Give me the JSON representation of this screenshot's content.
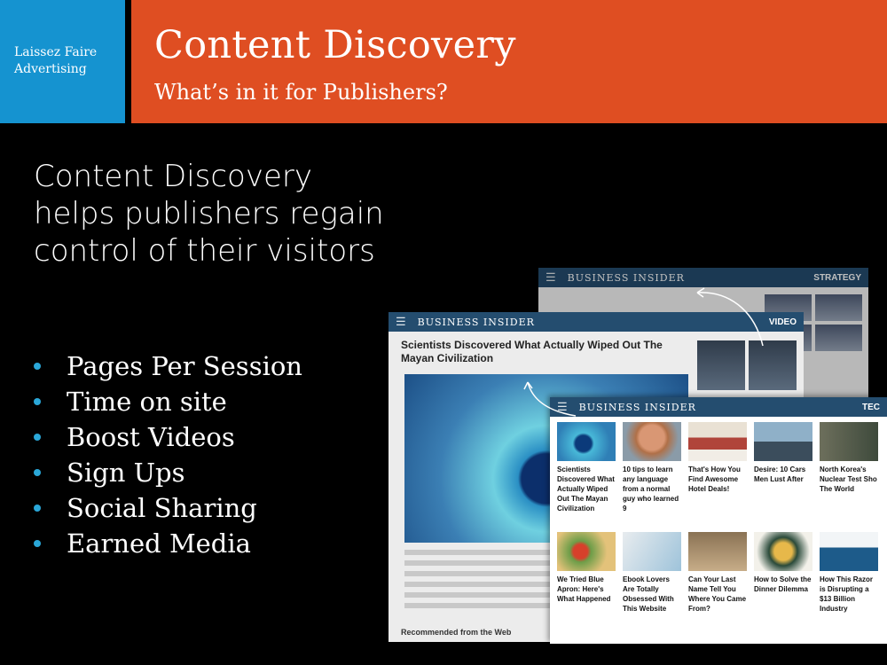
{
  "brand": {
    "line1": "Laissez Faire",
    "line2": "Advertising"
  },
  "header": {
    "title": "Content Discovery",
    "subtitle": "What’s in it for Publishers?"
  },
  "headline": {
    "line1": "Content Discovery",
    "line2": "helps publishers regain",
    "line3": "control of their visitors"
  },
  "bullets": [
    "Pages Per Session",
    "Time on site",
    "Boost Videos",
    "Sign Ups",
    "Social Sharing",
    "Earned Media"
  ],
  "colors": {
    "brand_blue": "#1593d0",
    "header_orange": "#df4e22",
    "bullet_dot": "#2aa7d8",
    "background": "#000000"
  },
  "screens": {
    "back": {
      "brand": "BUSINESS INSIDER",
      "section": "STRATEGY"
    },
    "mid": {
      "brand": "BUSINESS INSIDER",
      "section": "VIDEO",
      "article_title": "Scientists Discovered What Actually Wiped Out The Mayan Civilization",
      "recommended": "Recommended from the Web"
    },
    "front": {
      "brand": "BUSINESS INSIDER",
      "section": "TEC",
      "cards": [
        "Scientists Discovered What Actually Wiped Out The Mayan Civilization",
        "10 tips to learn any language from a normal guy who learned 9",
        "That's How You Find Awesome Hotel Deals!",
        "Desire: 10 Cars Men Lust After",
        "North Korea's Nuclear Test Sho The World",
        "We Tried Blue Apron: Here's What Happened",
        "Ebook Lovers Are Totally Obsessed With This Website",
        "Can Your Last Name Tell You Where You Came From?",
        "How to Solve the Dinner Dilemma",
        "How This Razor is Disrupting a $13 Billion Industry"
      ]
    }
  }
}
